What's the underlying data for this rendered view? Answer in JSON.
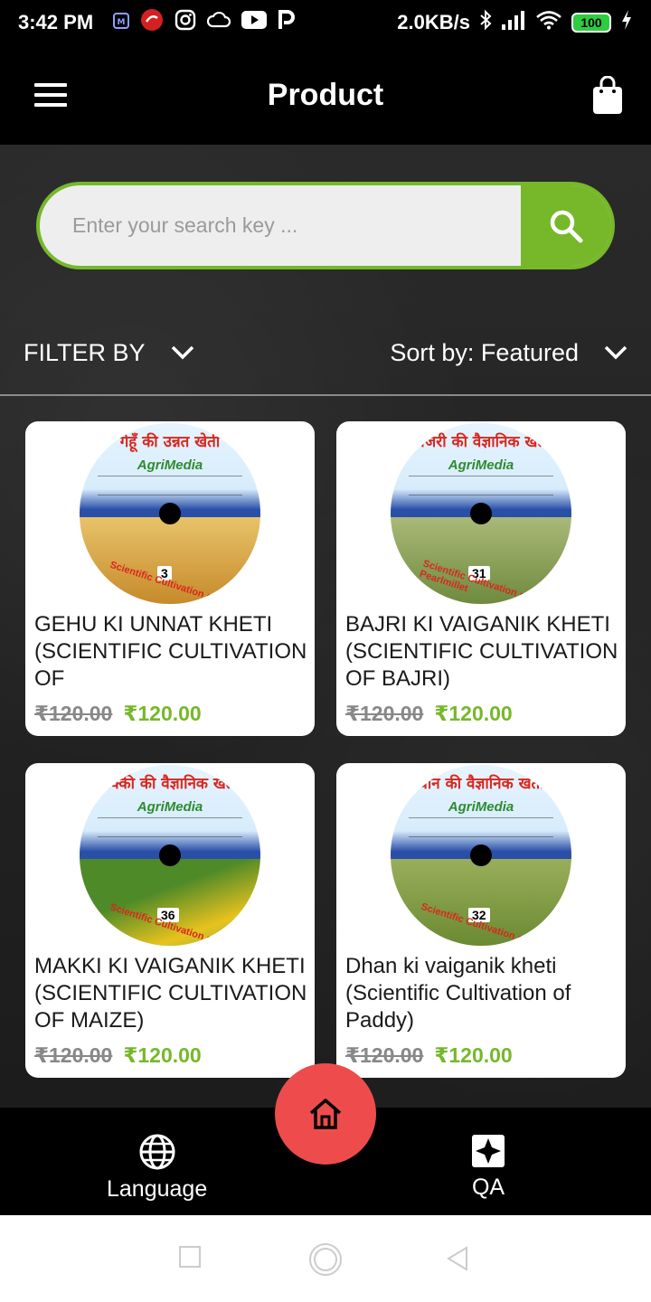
{
  "status_bar": {
    "time": "3:42 PM",
    "network_speed": "2.0KB/s",
    "battery": "100",
    "icons": [
      "mi-icon",
      "app-icon",
      "instagram-icon",
      "cloud-icon",
      "youtube-icon",
      "p-icon",
      "bluetooth-icon",
      "signal-icon",
      "wifi-icon",
      "battery-icon",
      "charging-icon"
    ]
  },
  "app_bar": {
    "title": "Product"
  },
  "search": {
    "placeholder": "Enter your search key ..."
  },
  "filter": {
    "filter_label": "FILTER BY",
    "sort_label": "Sort by: Featured"
  },
  "products": [
    {
      "title": "GEHU KI UNNAT KHETI (SCIENTIFIC CULTIVATION OF",
      "old_price": "₹120.00",
      "price": "₹120.00",
      "disc_number": "3",
      "disc_hindi": "गेहूँ की उन्नत खेती",
      "disc_brand": "AgriMedia",
      "disc_sub": "Scientific Cultivation of Wheat",
      "crop_color": "#d9a441"
    },
    {
      "title": "BAJRI KI VAIGANIK KHETI (SCIENTIFIC CULTIVATION OF BAJRI)",
      "old_price": "₹120.00",
      "price": "₹120.00",
      "disc_number": "31",
      "disc_hindi": "बाजरी की वैज्ञानिक खेती",
      "disc_brand": "AgriMedia",
      "disc_sub": "Scientific Cultivation of Pearlmillet",
      "crop_color": "#8fa85a"
    },
    {
      "title": "MAKKI KI VAIGANIK KHETI (SCIENTIFIC CULTIVATION OF MAIZE)",
      "old_price": "₹120.00",
      "price": "₹120.00",
      "disc_number": "36",
      "disc_hindi": "मक्की की वैज्ञानिक खेती",
      "disc_brand": "AgriMedia",
      "disc_sub": "Scientific Cultivation of Maize",
      "crop_color": "#5f9a2e"
    },
    {
      "title": "Dhan ki vaiganik kheti (Scientific Cultivation of Paddy)",
      "old_price": "₹120.00",
      "price": "₹120.00",
      "disc_number": "32",
      "disc_hindi": "धान की वैज्ञानिक खेती",
      "disc_brand": "AgriMedia",
      "disc_sub": "Scientific Cultivation of Paddy",
      "crop_color": "#7c9a3e"
    }
  ],
  "bottom_nav": {
    "language_label": "Language",
    "qa_label": "QA"
  },
  "colors": {
    "accent_green": "#76b82a",
    "fab_red": "#ee4c4c"
  }
}
